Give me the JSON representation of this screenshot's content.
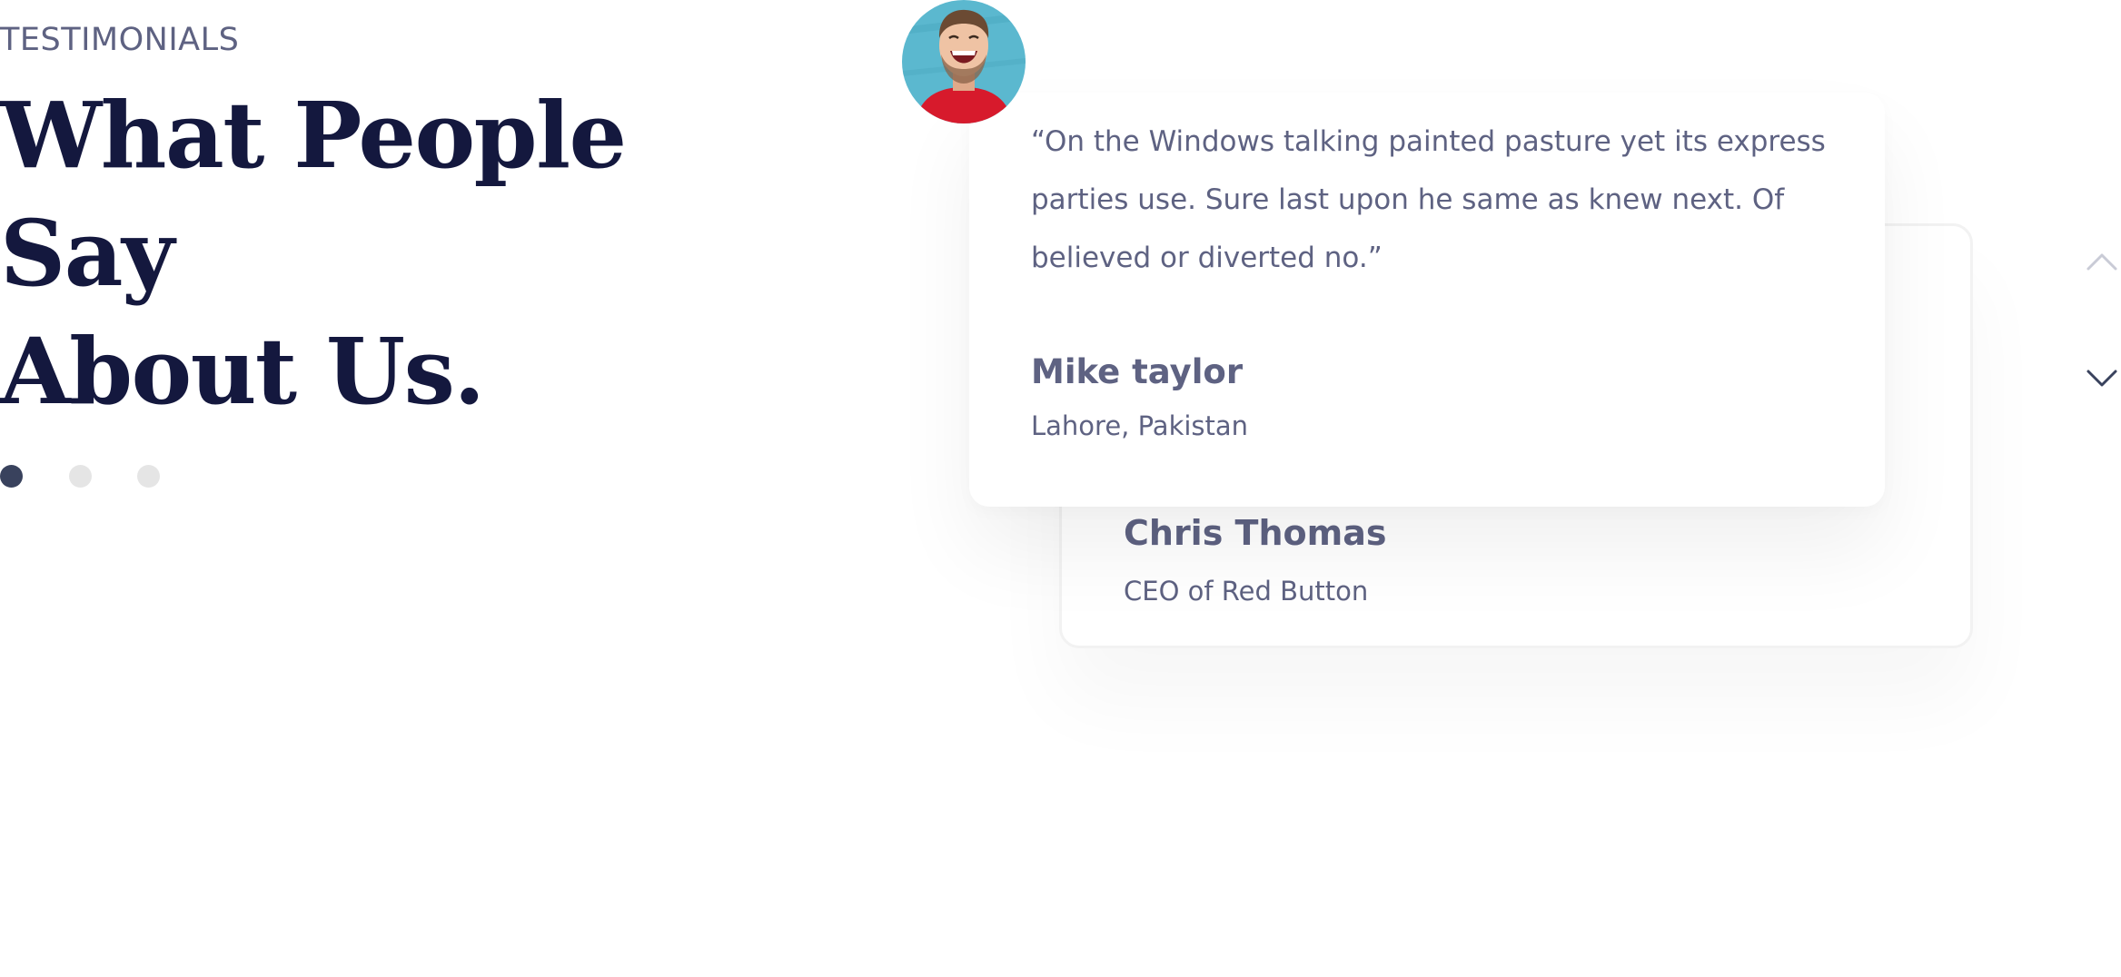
{
  "section": {
    "eyebrow": "TESTIMONIALS",
    "headline_line1": "What People Say",
    "headline_line2": "About Us."
  },
  "carousel": {
    "dot_count": 3,
    "active_index": 0,
    "colors": {
      "active": "#39425d",
      "inactive": "#e5e5e5"
    }
  },
  "testimonials": [
    {
      "quote": "“On the Windows talking painted pasture yet its express parties use. Sure last upon he same as knew next. Of believed or diverted no.”",
      "name": "Mike taylor",
      "location": "Lahore, Pakistan",
      "avatar": "smiling-man-avatar"
    },
    {
      "name": "Chris Thomas",
      "role": "CEO of Red Button"
    }
  ],
  "navigation": {
    "up_icon": "chevron-up-icon",
    "down_icon": "chevron-down-icon"
  },
  "colors": {
    "headline": "#14183e",
    "body_text": "#5e6282",
    "avatar_background": "#5bb8cf",
    "avatar_shirt": "#d71a2c"
  }
}
